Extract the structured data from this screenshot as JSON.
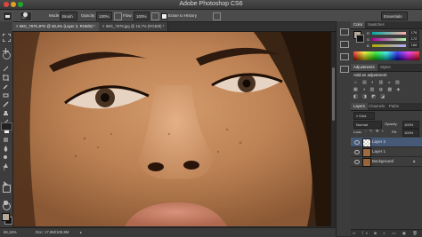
{
  "window": {
    "title": "Adobe Photoshop CS6",
    "workspace": "Essentials"
  },
  "options_bar": {
    "brush_size": "127",
    "mode_label": "Mode:",
    "mode_value": "Brush",
    "opacity_label": "Opacity:",
    "opacity_value": "100%",
    "flow_label": "Flow:",
    "flow_value": "100%",
    "erase_history": "Erase to History"
  },
  "tabs": [
    {
      "label": "IMG_7878.JPG @ 50,4% (Layer 2, RGB/8) *"
    },
    {
      "label": "IMG_7878.jpg @ 16,7% (RGB/8) *"
    }
  ],
  "status_bar": {
    "zoom": "66,16%",
    "doc": "Doc: 17,9M/109,9M"
  },
  "color_panel": {
    "tabs": [
      "Color",
      "Swatches"
    ],
    "channels": [
      {
        "label": "R",
        "value": "176"
      },
      {
        "label": "G",
        "value": "172"
      },
      {
        "label": "B",
        "value": "166"
      }
    ]
  },
  "adjustments_panel": {
    "tabs": [
      "Adjustments",
      "Styles"
    ],
    "heading": "Add an adjustment"
  },
  "layers_panel": {
    "tabs": [
      "Layers",
      "Channels",
      "Paths"
    ],
    "kind": "Kind",
    "blend_mode": "Normal",
    "opacity_label": "Opacity:",
    "opacity": "100%",
    "lock_label": "Lock:",
    "fill_label": "Fill:",
    "fill": "100%",
    "layers": [
      {
        "name": "Layer 2",
        "selected": true
      },
      {
        "name": "Layer 1",
        "selected": false
      },
      {
        "name": "Background",
        "selected": false
      }
    ]
  },
  "colors": {
    "accent": "#3d6aa8",
    "panel": "#3d3d3d",
    "selected_layer": "#465a78"
  }
}
